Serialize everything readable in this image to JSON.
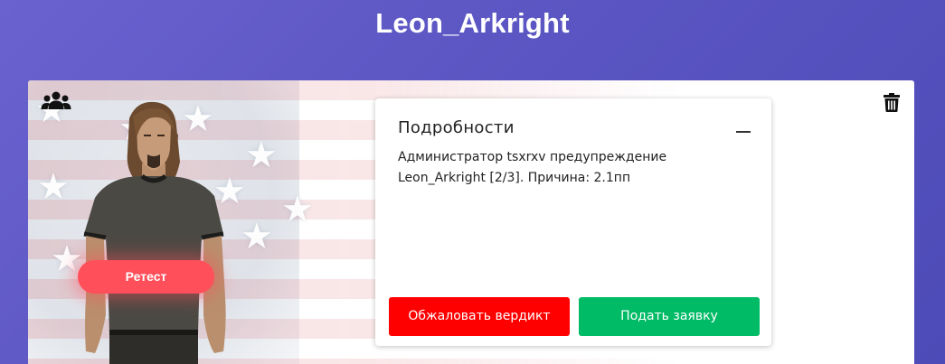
{
  "header": {
    "title": "Leon_Arkright"
  },
  "card": {
    "retest_label": "Ретест",
    "details": {
      "title": "Подробности",
      "text": "Администратор tsxrxv предупреждение Leon_Arkright [2/3]. Причина: 2.1пп",
      "appeal_label": "Обжаловать вердикт",
      "apply_label": "Подать заявку"
    }
  },
  "colors": {
    "background": "#5a55c2",
    "retest": "#ff4f5a",
    "appeal": "#ff0000",
    "apply": "#00bb66"
  },
  "icons": [
    "users-icon",
    "trash-icon",
    "minus-icon"
  ]
}
